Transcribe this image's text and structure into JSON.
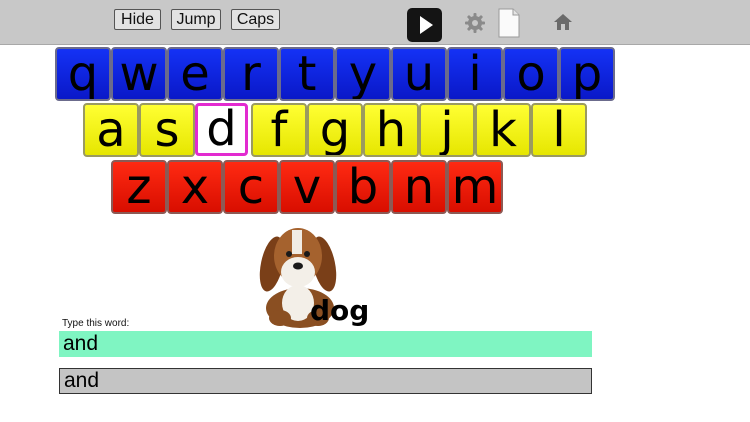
{
  "toolbar": {
    "hide_label": "Hide",
    "jump_label": "Jump",
    "caps_label": "Caps",
    "play_icon": "play-icon",
    "settings_icon": "gear-icon",
    "document_icon": "document-icon",
    "home_icon": "home-icon"
  },
  "keyboard": {
    "row1": [
      "q",
      "w",
      "e",
      "r",
      "t",
      "y",
      "u",
      "i",
      "o",
      "p"
    ],
    "row2": [
      "a",
      "s",
      "d",
      "f",
      "g",
      "h",
      "j",
      "k",
      "l"
    ],
    "row3": [
      "z",
      "x",
      "c",
      "v",
      "b",
      "n",
      "m"
    ],
    "selected_key": "d",
    "colors": {
      "row1": "#0a18c8",
      "row2": "#ffff00",
      "row3": "#ff1a00",
      "selected_border": "#e22ad0"
    }
  },
  "picture": {
    "word": "dog"
  },
  "prompt": {
    "label": "Type this word:",
    "target_word": "and",
    "typed_value": "and",
    "target_bg": "#7ff5c2"
  }
}
